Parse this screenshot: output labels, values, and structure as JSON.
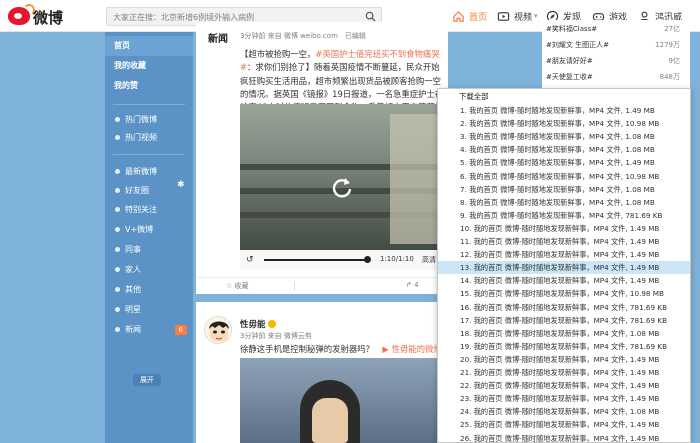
{
  "logo": {
    "text": "微博"
  },
  "search": {
    "placeholder": "大家正在搜：北京新增6例境外输入病例"
  },
  "nav": [
    {
      "label": "首页"
    },
    {
      "label": "视频"
    },
    {
      "label": "发现"
    },
    {
      "label": "游戏"
    },
    {
      "label": "鸿迅威"
    }
  ],
  "leftnav": {
    "main": [
      "首页",
      "我的收藏",
      "我的赞"
    ],
    "hot": [
      "热门微博",
      "热门视频"
    ],
    "groups": [
      "最新微博",
      "好友圈",
      "特别关注",
      "V+微博",
      "同事",
      "家人",
      "其他",
      "明星",
      "新闻"
    ],
    "news_badge": "6",
    "collapse": "展开"
  },
  "post1": {
    "author_logo": "新闻",
    "text_before": "【超市被抢购一空，",
    "tag": "#英国护士值完班买不到食物痛哭#",
    "text_after": "：求你们别抢了】随着英国疫情不断蔓延，民众开始疯狂购买生活用品，超市频繁出现货品被顾客抢购一空的情况。据英国《镜报》19日报道，一名急重症护士在结束48小时的值班后买不到食物，看着超市里空荡荡的货架，忍不住泪流满",
    "meta": "3分钟前 来自 微博 weibo.com　已编辑",
    "video_time": "1:10/1:10",
    "video_hd": "高清",
    "fav": "收藏",
    "forward": "4"
  },
  "post2": {
    "author": "性毋能",
    "meta": "3分钟前 来自 微博云剪",
    "text": "徐静这手机是控制秘弹的发射器吗？",
    "link": "性毋能的微博"
  },
  "trends": [
    {
      "name": "#笑料福Class#",
      "count": "27亿"
    },
    {
      "name": "#刘耀文 生图正人#",
      "count": "1279万"
    },
    {
      "name": "#朋友请好好#",
      "count": "9亿"
    },
    {
      "name": "#天使复工收#",
      "count": "848万"
    }
  ],
  "dropdown": {
    "header": "下载全部",
    "highlight_index": 12,
    "items": [
      "1.  我的首页 微博-随时随地发现新鲜事，MP4 文件, 1.49 MB",
      "2.  我的首页 微博-随时随地发现新鲜事，MP4 文件, 10.98 MB",
      "3.  我的首页 微博-随时随地发现新鲜事，MP4 文件, 1.08 MB",
      "4.  我的首页 微博-随时随地发现新鲜事，MP4 文件, 1.08 MB",
      "5.  我的首页 微博-随时随地发现新鲜事，MP4 文件, 1.49 MB",
      "6.  我的首页 微博-随时随地发现新鲜事，MP4 文件, 10.98 MB",
      "7.  我的首页 微博-随时随地发现新鲜事，MP4 文件, 1.08 MB",
      "8.  我的首页 微博-随时随地发现新鲜事，MP4 文件, 1.08 MB",
      "9.  我的首页 微博-随时随地发现新鲜事，MP4 文件, 781.69 KB",
      "10.  我的首页 微博-随时随地发现新鲜事，MP4 文件, 1.49 MB",
      "11.  我的首页 微博-随时随地发现新鲜事，MP4 文件, 1.49 MB",
      "12.  我的首页 微博-随时随地发现新鲜事，MP4 文件, 1.49 MB",
      "13.  我的首页 微博-随时随地发现新鲜事，MP4 文件, 1.49 MB",
      "14.  我的首页 微博-随时随地发现新鲜事，MP4 文件, 1.49 MB",
      "15.  我的首页 微博-随时随地发现新鲜事，MP4 文件, 10.98 MB",
      "16.  我的首页 微博-随时随地发现新鲜事，MP4 文件, 781.69 KB",
      "17.  我的首页 微博-随时随地发现新鲜事，MP4 文件, 781.69 KB",
      "18.  我的首页 微博-随时随地发现新鲜事，MP4 文件, 1.08 MB",
      "19.  我的首页 微博-随时随地发现新鲜事，MP4 文件, 781.69 KB",
      "20.  我的首页 微博-随时随地发现新鲜事，MP4 文件, 1.49 MB",
      "21.  我的首页 微博-随时随地发现新鲜事，MP4 文件, 1.49 MB",
      "22.  我的首页 微博-随时随地发现新鲜事，MP4 文件, 1.49 MB",
      "23.  我的首页 微博-随时随地发现新鲜事，MP4 文件, 1.49 MB",
      "24.  我的首页 微博-随时随地发现新鲜事，MP4 文件, 1.08 MB",
      "25.  我的首页 微博-随时随地发现新鲜事，MP4 文件, 1.49 MB",
      "26.  我的首页 微博-随时随地发现新鲜事，MP4 文件, 1.49 MB"
    ]
  },
  "colors": {
    "accent": "#fa7d3c",
    "brand_red": "#e6162d",
    "sidebar": "#5b93c6",
    "page_bg": "#7fb2d8",
    "dropdown_highlight": "#cde6f7"
  }
}
